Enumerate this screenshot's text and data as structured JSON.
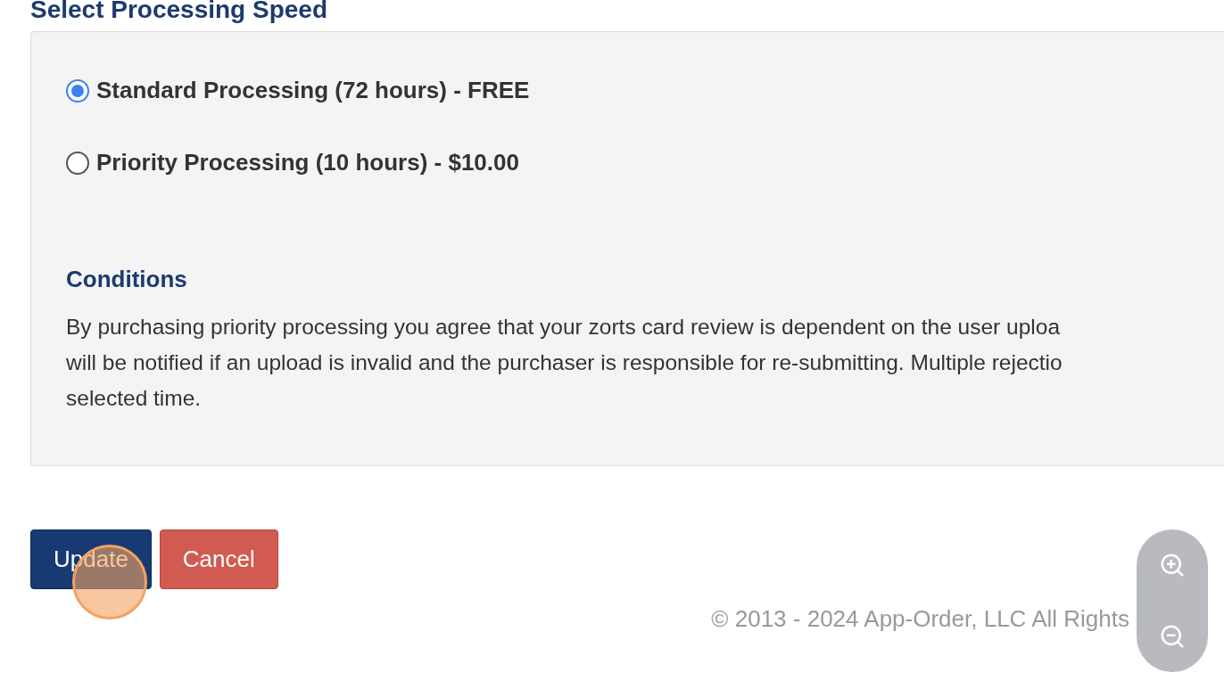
{
  "heading": "Select Processing Speed",
  "options": [
    {
      "label": "Standard Processing (72 hours) - FREE",
      "selected": true
    },
    {
      "label": "Priority Processing (10 hours) - $10.00",
      "selected": false
    }
  ],
  "conditions": {
    "title": "Conditions",
    "lines": [
      "By purchasing priority processing you agree that your zorts card review is dependent on the user uploa",
      "will be notified if an upload is invalid and the purchaser is responsible for re-submitting. Multiple rejectio",
      "selected time."
    ]
  },
  "buttons": [
    {
      "label": "Update",
      "kind": "primary"
    },
    {
      "label": "Cancel",
      "kind": "danger"
    }
  ],
  "footer": "© 2013 - 2024 App-Order, LLC All Rights"
}
